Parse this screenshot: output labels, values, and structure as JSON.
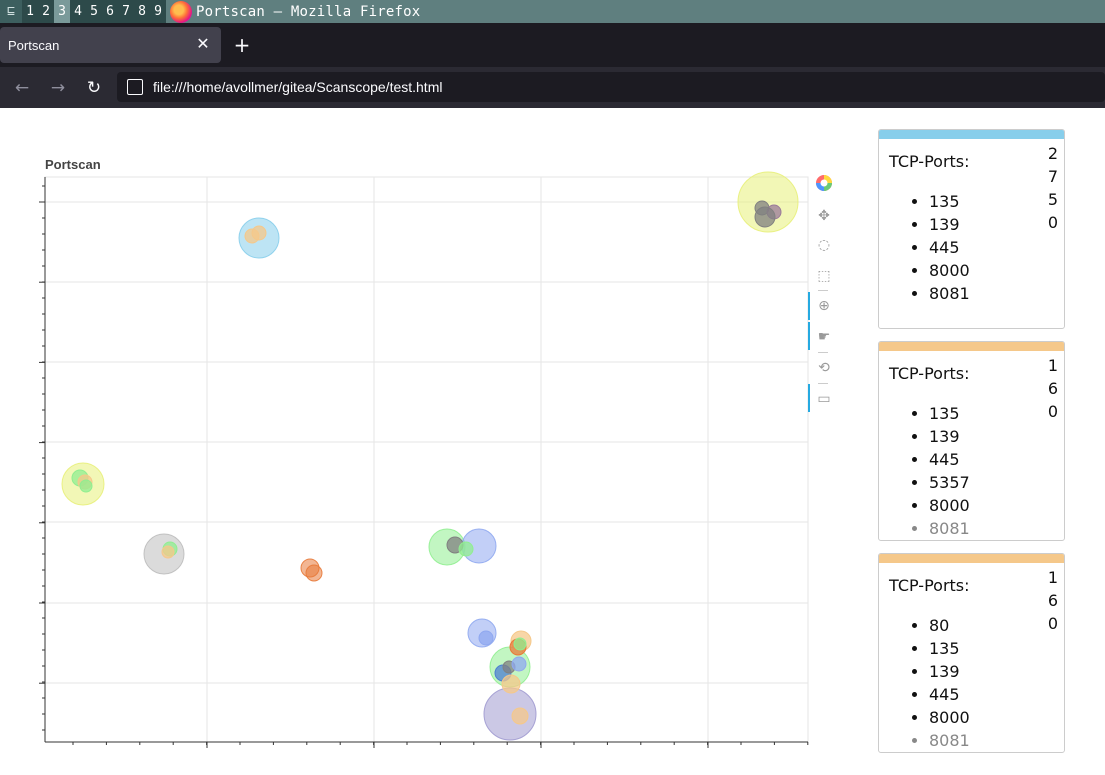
{
  "wm": {
    "workspaces": [
      "1",
      "2",
      "3",
      "4",
      "5",
      "6",
      "7",
      "8",
      "9"
    ],
    "title": "Portscan — Mozilla Firefox"
  },
  "tab": {
    "title": "Portscan"
  },
  "nav": {
    "url": "file:///home/avollmer/gitea/Scanscope/test.html"
  },
  "plot": {
    "title": "Portscan",
    "toolbar": [
      "bokeh-logo-icon",
      "pan-icon",
      "lasso-select-icon",
      "box-select-icon",
      "wheel-zoom-icon",
      "tap-icon",
      "reset-icon",
      "hover-icon"
    ]
  },
  "chart_data": {
    "type": "scatter",
    "title": "Portscan",
    "grid": true,
    "note": "bubble chart; axis tick labels not rendered",
    "series": [
      {
        "color": "#87ceeb",
        "points": [
          [
            259,
            238,
            20
          ]
        ]
      },
      {
        "color": "#e8f07a",
        "points": [
          [
            768,
            202,
            30
          ],
          [
            83,
            484,
            21
          ]
        ]
      },
      {
        "color": "#bdbdbd",
        "points": [
          [
            164,
            554,
            20
          ]
        ]
      },
      {
        "color": "#90ee90",
        "points": [
          [
            447,
            547,
            18
          ],
          [
            510,
            667,
            20
          ]
        ]
      },
      {
        "color": "#8fa8f0",
        "points": [
          [
            479,
            546,
            17
          ],
          [
            482,
            633,
            14
          ]
        ]
      },
      {
        "color": "#a09ad0",
        "points": [
          [
            510,
            714,
            26
          ]
        ]
      },
      {
        "color": "#e87a3a",
        "points": [
          [
            310,
            568,
            9
          ],
          [
            314,
            573,
            8
          ]
        ]
      }
    ]
  },
  "cards": [
    {
      "color": "#87ceeb",
      "label": "TCP-Ports:",
      "count": "2750",
      "ports": [
        "135",
        "139",
        "445",
        "8000",
        "8081"
      ]
    },
    {
      "color": "#f5c88a",
      "label": "TCP-Ports:",
      "count": "160",
      "ports": [
        "135",
        "139",
        "445",
        "5357",
        "8000",
        "8081"
      ]
    },
    {
      "color": "#f5c88a",
      "label": "TCP-Ports:",
      "count": "160",
      "ports": [
        "80",
        "135",
        "139",
        "445",
        "8000",
        "8081"
      ]
    }
  ]
}
